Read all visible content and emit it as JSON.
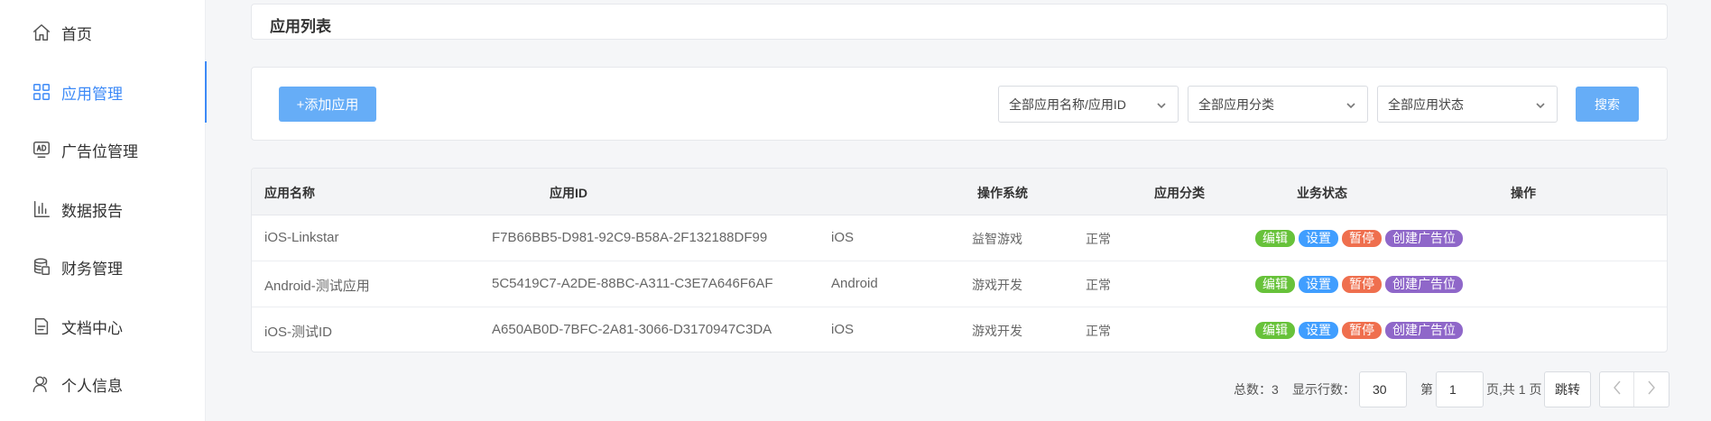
{
  "sidebar": {
    "items": [
      {
        "label": "首页",
        "icon": "home-icon"
      },
      {
        "label": "应用管理",
        "icon": "grid-icon",
        "active": true
      },
      {
        "label": "广告位管理",
        "icon": "ad-icon"
      },
      {
        "label": "数据报告",
        "icon": "bar-chart-icon"
      },
      {
        "label": "财务管理",
        "icon": "database-icon"
      },
      {
        "label": "文档中心",
        "icon": "document-icon"
      },
      {
        "label": "个人信息",
        "icon": "user-icon"
      }
    ]
  },
  "page": {
    "title": "应用列表"
  },
  "filters": {
    "add_label": "+添加应用",
    "name_select": "全部应用名称/应用ID",
    "category_select": "全部应用分类",
    "status_select": "全部应用状态",
    "search_label": "搜索"
  },
  "table": {
    "headers": [
      "应用名称",
      "应用ID",
      "操作系统",
      "应用分类",
      "业务状态",
      "操作"
    ],
    "rows": [
      {
        "name": "iOS-Linkstar",
        "id": "F7B66BB5-D981-92C9-B58A-2F132188DF99",
        "os": "iOS",
        "category": "益智游戏",
        "status": "正常"
      },
      {
        "name": "Android-测试应用",
        "id": "5C5419C7-A2DE-88BC-A311-C3E7A646F6AF",
        "os": "Android",
        "category": "游戏开发",
        "status": "正常"
      },
      {
        "name": "iOS-测试ID",
        "id": "A650AB0D-7BFC-2A81-3066-D3170947C3DA",
        "os": "iOS",
        "category": "游戏开发",
        "status": "正常"
      }
    ],
    "actions": {
      "edit": "编辑",
      "settings": "设置",
      "pause": "暂停",
      "create_slot": "创建广告位"
    }
  },
  "pagination": {
    "total_label": "总数：3",
    "rows_label": "显示行数：",
    "rows_value": "30",
    "page_prefix": "第",
    "page_value": "1",
    "page_suffix": "页,共 1 页",
    "jump_label": "跳转"
  },
  "colors": {
    "accent": "#3d8af7",
    "primary_button": "#66adf7",
    "tag_edit": "#67c23a",
    "tag_settings": "#409eff",
    "tag_pause": "#ef6f4e",
    "tag_create": "#8f67c9"
  }
}
